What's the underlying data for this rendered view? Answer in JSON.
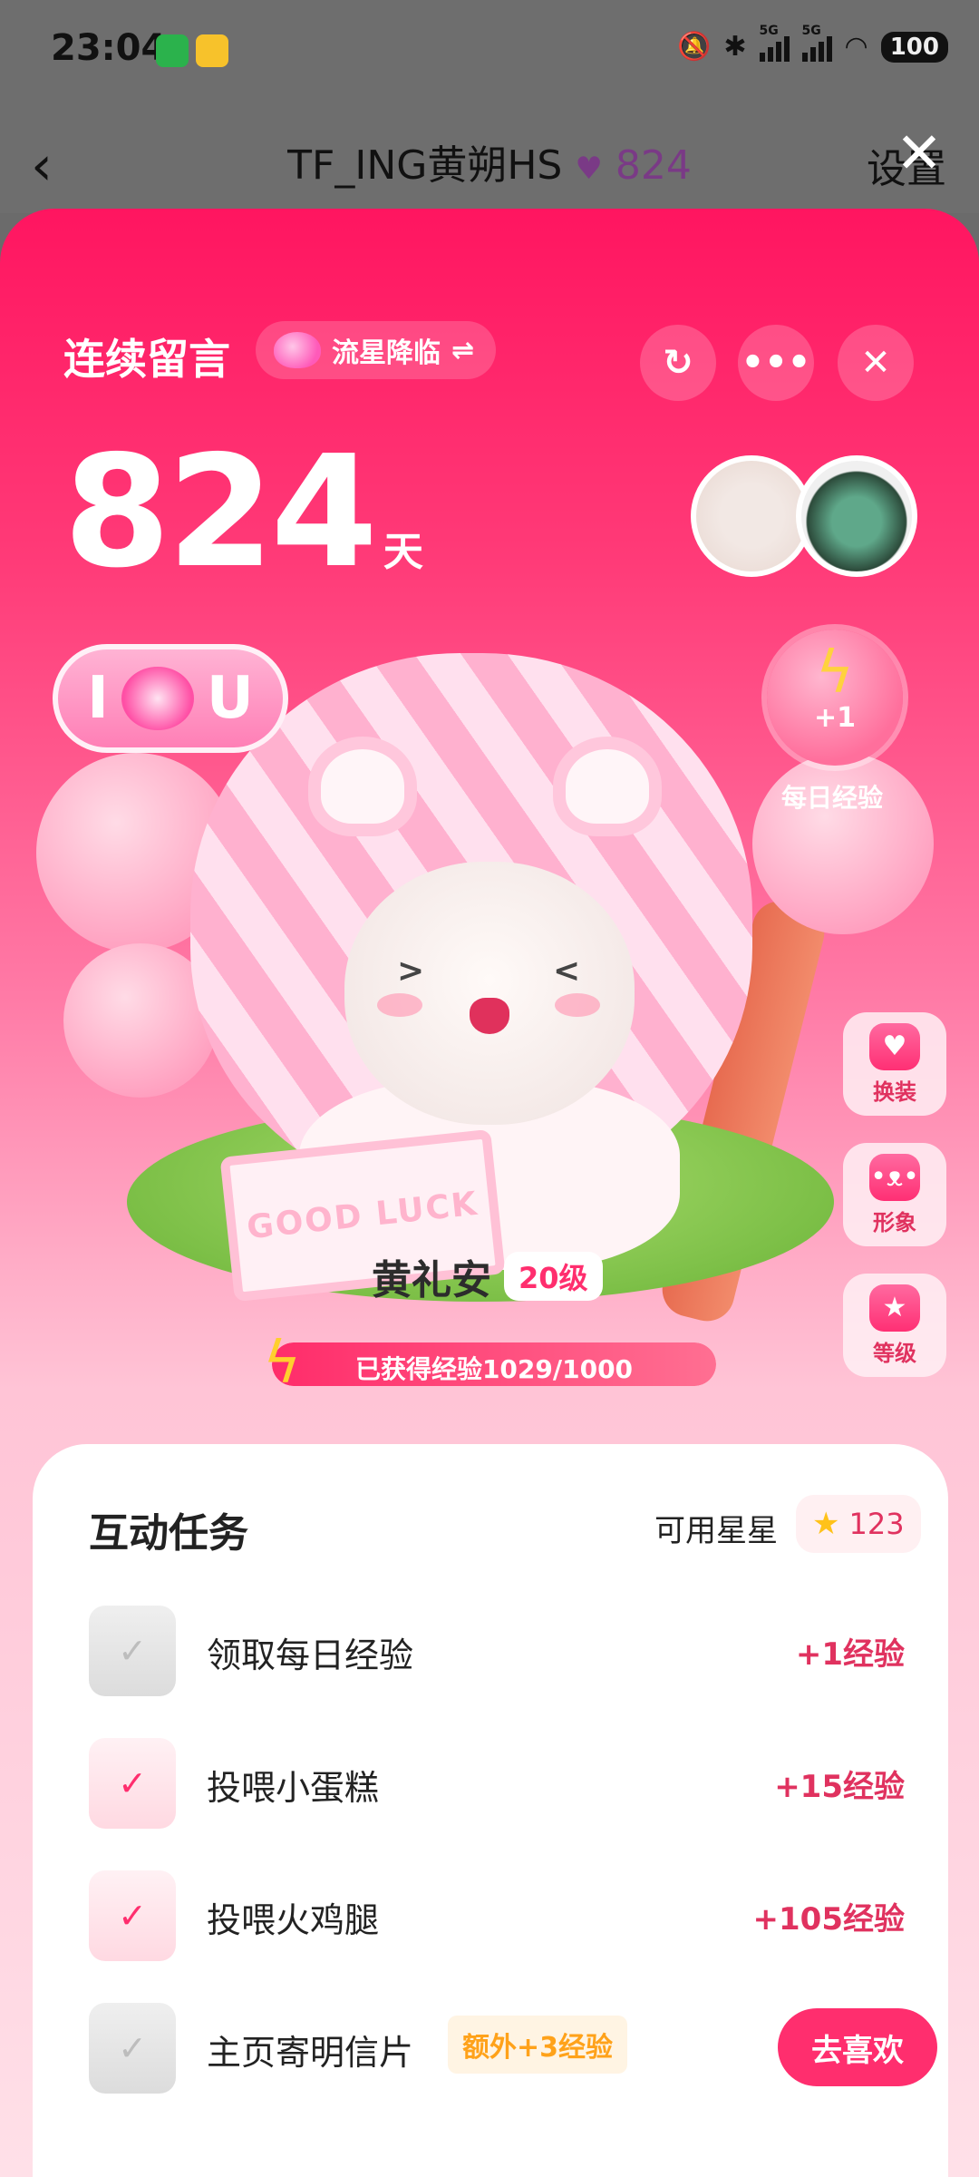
{
  "status_bar": {
    "time": "23:04",
    "battery": "100",
    "network_a": "5G",
    "network_b": "5G"
  },
  "nav": {
    "title": "TF_ING黄朔HS",
    "heart_count": "824",
    "settings": "设置"
  },
  "header": {
    "title": "连续留言",
    "mode_label": "流星降临",
    "mode_swap": "⇌"
  },
  "streak": {
    "days": "824",
    "unit": "天"
  },
  "iu_badge": {
    "left": "I",
    "right": "U"
  },
  "book": {
    "text": "GOOD LUCK"
  },
  "daily_exp": {
    "value": "+1",
    "label": "每日经验"
  },
  "side_buttons": [
    {
      "label": "换装",
      "icon": "outfit-icon"
    },
    {
      "label": "形象",
      "icon": "pig-face-icon"
    },
    {
      "label": "等级",
      "icon": "star-badge-icon"
    }
  ],
  "pet": {
    "name": "黄礼安",
    "level": "20级"
  },
  "exp_bar": {
    "text": "已获得经验1029/1000",
    "progress": 1.0
  },
  "tasks": {
    "title": "互动任务",
    "stars_label": "可用星星",
    "stars_count": "123",
    "items": [
      {
        "label": "领取每日经验",
        "reward": "+1经验",
        "done": true
      },
      {
        "label": "投喂小蛋糕",
        "reward": "+15经验",
        "done": false
      },
      {
        "label": "投喂火鸡腿",
        "reward": "+105经验",
        "done": false
      },
      {
        "label": "主页寄明信片",
        "extra": "额外+3经验",
        "action": "去喜欢",
        "done": true
      }
    ]
  },
  "colors": {
    "accent": "#ff2e6e",
    "streak_top": "#ff1560",
    "grass": "#79bd44"
  }
}
